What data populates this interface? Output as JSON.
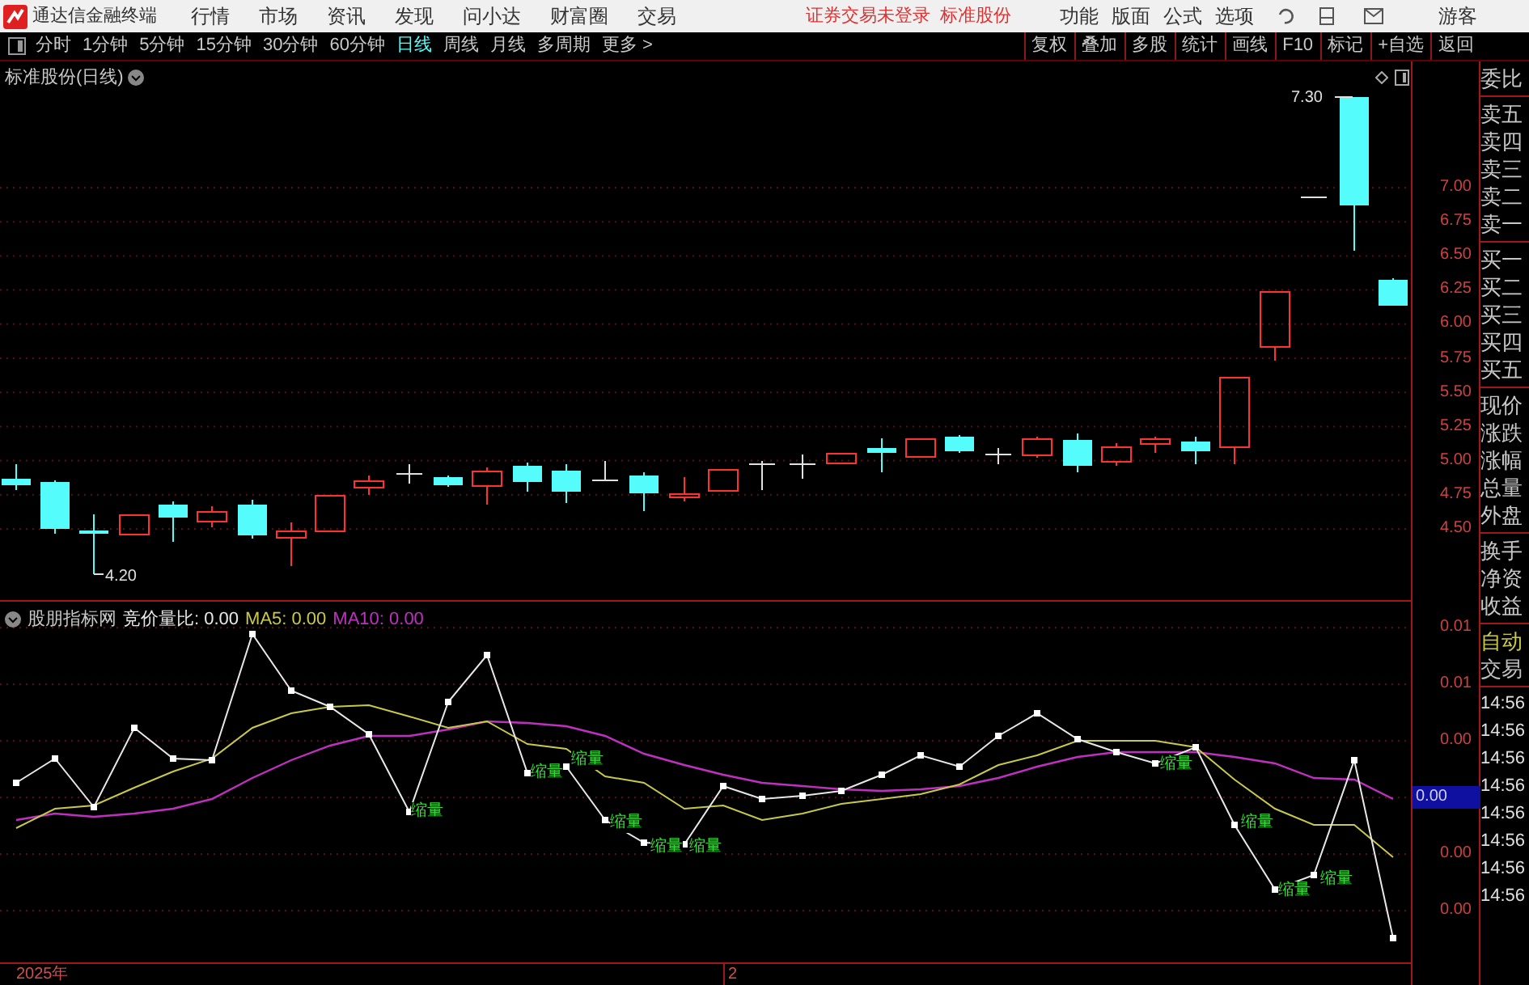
{
  "app": {
    "name": "通达信金融终端"
  },
  "menu": [
    "行情",
    "市场",
    "资讯",
    "发现",
    "问小达",
    "财富圈",
    "交易"
  ],
  "login_status": "证券交易未登录",
  "stock_name": "标准股份",
  "right_menu": [
    "功能",
    "版面",
    "公式",
    "选项"
  ],
  "user": "游客",
  "periods": [
    {
      "label": "分时",
      "selected": false
    },
    {
      "label": "1分钟",
      "selected": false
    },
    {
      "label": "5分钟",
      "selected": false
    },
    {
      "label": "15分钟",
      "selected": false
    },
    {
      "label": "30分钟",
      "selected": false
    },
    {
      "label": "60分钟",
      "selected": false
    },
    {
      "label": "日线",
      "selected": true
    },
    {
      "label": "周线",
      "selected": false
    },
    {
      "label": "月线",
      "selected": false
    },
    {
      "label": "多周期",
      "selected": false
    },
    {
      "label": "更多 >",
      "selected": false
    }
  ],
  "tools": [
    "复权",
    "叠加",
    "多股",
    "统计",
    "画线",
    "F10",
    "标记",
    "+自选",
    "返回"
  ],
  "price_chart": {
    "title": "标准股份(日线)",
    "y_axis": [
      "7.00",
      "6.75",
      "6.50",
      "6.25",
      "6.00",
      "5.75",
      "5.50",
      "5.25",
      "5.00",
      "4.75",
      "4.50"
    ],
    "high_label": "7.30",
    "low_label": "4.20"
  },
  "indicator": {
    "name": "股朋指标网",
    "ratio_label": "竞价量比: 0.00",
    "ma5_label": "MA5: 0.00",
    "ma10_label": "MA10: 0.00",
    "y_axis": [
      {
        "label": "0.01",
        "highlighted": false
      },
      {
        "label": "0.01",
        "highlighted": false
      },
      {
        "label": "0.00",
        "highlighted": false
      },
      {
        "label": "0.00",
        "highlighted": true
      },
      {
        "label": "0.00",
        "highlighted": false
      },
      {
        "label": "0.00",
        "highlighted": false
      }
    ],
    "markers": [
      "缩量",
      "缩量",
      "缩量",
      "缩量",
      "缩量",
      "缩量",
      "缩量",
      "缩量",
      "缩量",
      "缩量"
    ]
  },
  "date_axis": [
    "2025年",
    "2"
  ],
  "quote_panel": {
    "groups": [
      [
        "委比"
      ],
      [
        "卖五",
        "卖四",
        "卖三",
        "卖二",
        "卖一"
      ],
      [
        "买一",
        "买二",
        "买三",
        "买四",
        "买五"
      ],
      [
        "现价",
        "涨跌",
        "涨幅",
        "总量",
        "外盘"
      ],
      [
        "换手",
        "净资",
        "收益"
      ]
    ],
    "trade": [
      {
        "label": "自动",
        "color": "#c8c84a"
      },
      {
        "label": "交易",
        "color": "#c0c0c0"
      }
    ],
    "times": [
      "14:56",
      "14:56",
      "14:56",
      "14:56",
      "14:56",
      "14:56",
      "14:56",
      "14:56"
    ]
  }
}
